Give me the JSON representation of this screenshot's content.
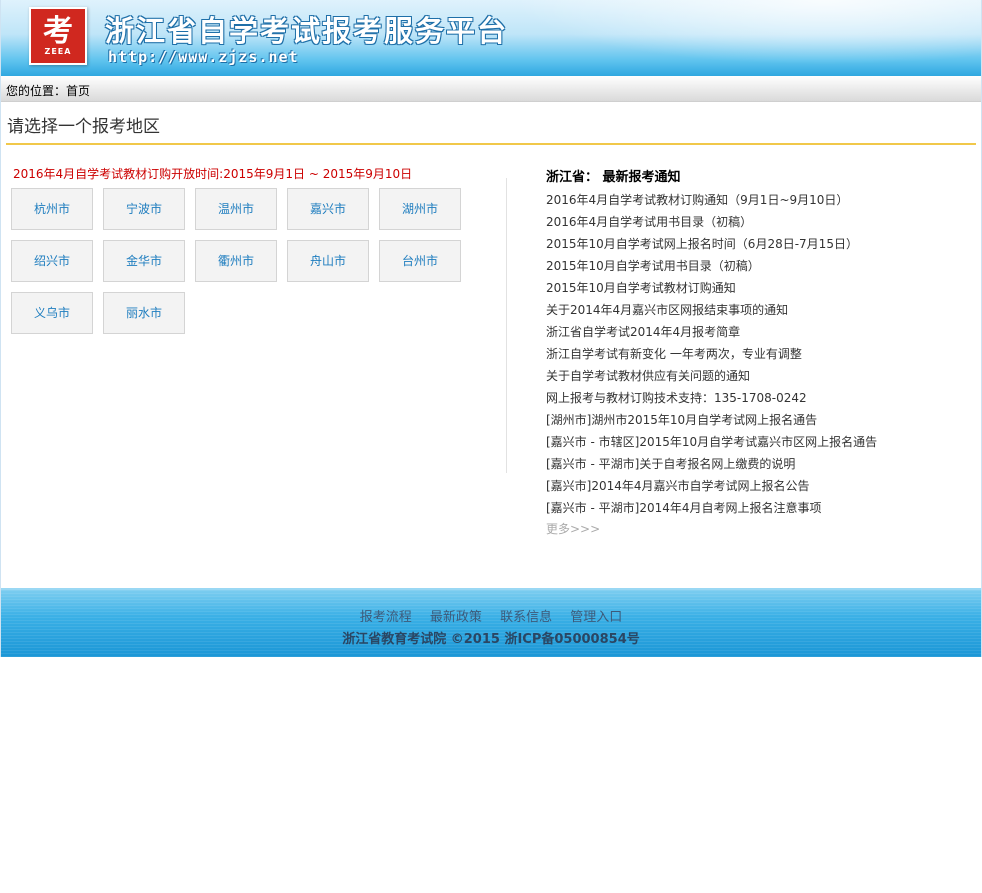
{
  "header": {
    "logo_glyph": "考",
    "logo_abbr": "ZEEA",
    "title": "浙江省自学考试报考服务平台",
    "url": "http://www.zjzs.net"
  },
  "breadcrumb": {
    "prefix": "您的位置：",
    "current": "首页"
  },
  "main": {
    "section_title": "请选择一个报考地区",
    "notice": "2016年4月自学考试教材订购开放时间:2015年9月1日 ~ 2015年9月10日",
    "cities": [
      "杭州市",
      "宁波市",
      "温州市",
      "嘉兴市",
      "湖州市",
      "绍兴市",
      "金华市",
      "衢州市",
      "舟山市",
      "台州市",
      "义乌市",
      "丽水市"
    ]
  },
  "news": {
    "title": "浙江省： 最新报考通知",
    "items": [
      "2016年4月自学考试教材订购通知（9月1日~9月10日）",
      "2016年4月自学考试用书目录（初稿）",
      "2015年10月自学考试网上报名时间（6月28日-7月15日）",
      "2015年10月自学考试用书目录（初稿）",
      "2015年10月自学考试教材订购通知",
      "关于2014年4月嘉兴市区网报结束事项的通知",
      "浙江省自学考试2014年4月报考简章",
      "浙江自学考试有新变化 一年考两次，专业有调整",
      "关于自学考试教材供应有关问题的通知",
      "网上报考与教材订购技术支持：135-1708-0242",
      "[湖州市]湖州市2015年10月自学考试网上报名通告",
      "[嘉兴市 - 市辖区]2015年10月自学考试嘉兴市区网上报名通告",
      "[嘉兴市 - 平湖市]关于自考报名网上缴费的说明",
      "[嘉兴市]2014年4月嘉兴市自学考试网上报名公告",
      "[嘉兴市 - 平湖市]2014年4月自考网上报名注意事项"
    ],
    "more": "更多>>>"
  },
  "footer": {
    "links": [
      "报考流程",
      "最新政策",
      "联系信息",
      "管理入口"
    ],
    "copyright": "浙江省教育考试院 ©2015 浙ICP备05000854号"
  },
  "colors": {
    "accent_rule": "#f1c84a",
    "notice_red": "#cc0000",
    "city_link": "#1e7dbf",
    "header_blue": "#2fa7e0"
  }
}
